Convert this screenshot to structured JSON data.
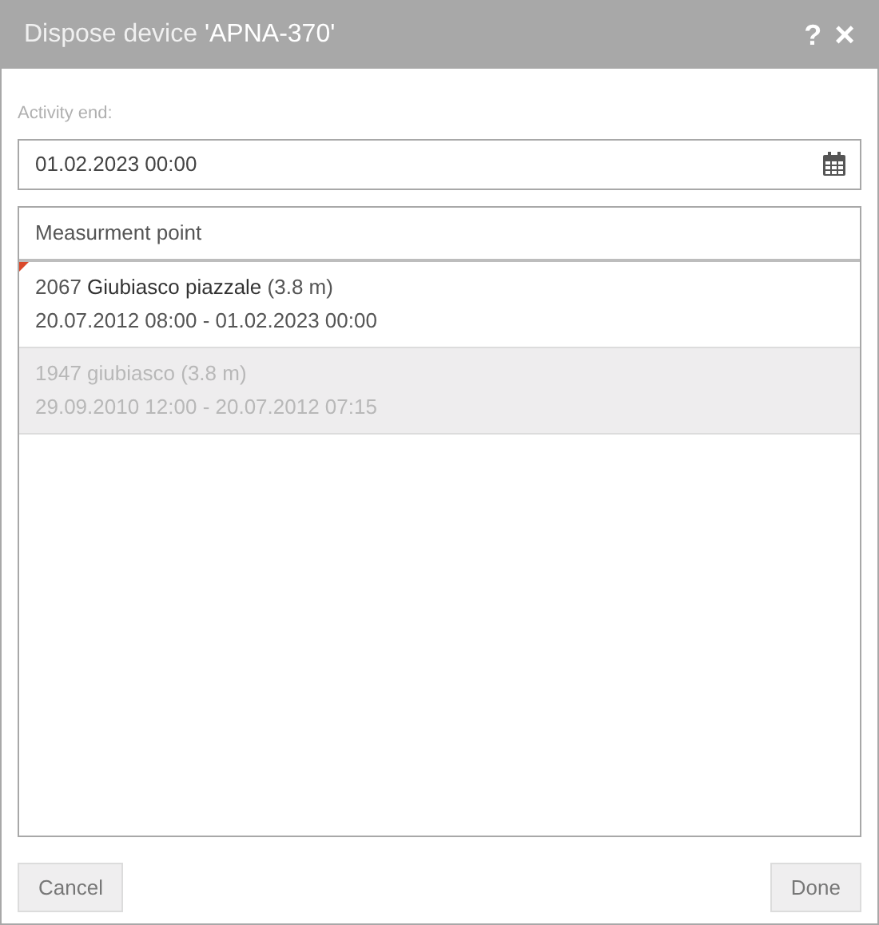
{
  "window": {
    "title_prefix": "Dispose device ",
    "device_name": "'APNA-370'",
    "help": "?",
    "close": "×"
  },
  "activity_end": {
    "label": "Activity end:",
    "value": "01.02.2023 00:00"
  },
  "list": {
    "header": "Measurment point",
    "rows": [
      {
        "number": "2067",
        "name": "Giubiasco piazzale",
        "height": "(3.8 m)",
        "period": "20.07.2012 08:00 - 01.02.2023 00:00",
        "selected": true,
        "disabled": false
      },
      {
        "number": "1947",
        "name": "giubiasco",
        "height": "(3.8 m)",
        "period": "29.09.2010 12:00 - 20.07.2012 07:15",
        "selected": false,
        "disabled": true
      }
    ]
  },
  "buttons": {
    "cancel": "Cancel",
    "done": "Done"
  }
}
